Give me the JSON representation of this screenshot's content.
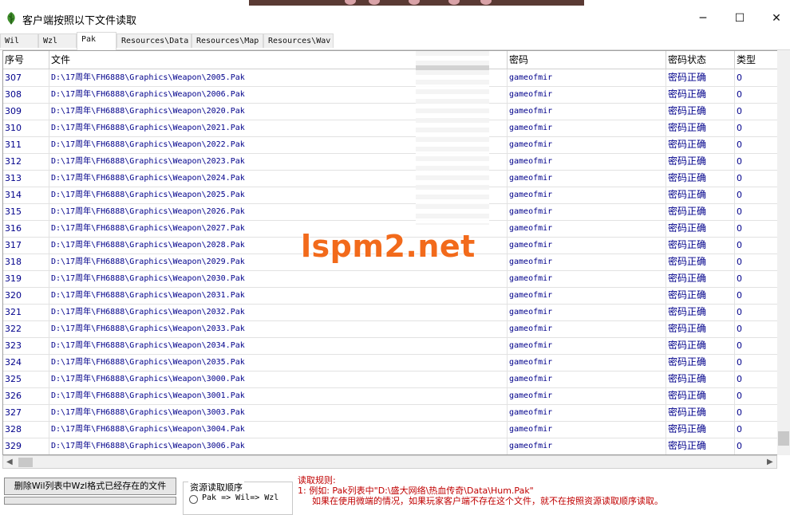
{
  "window": {
    "title": "客户端按照以下文件读取",
    "minimize": "─",
    "maximize": "☐",
    "close": "✕"
  },
  "tabs": [
    "Wil",
    "Wzl",
    "Pak",
    "Resources\\Data",
    "Resources\\Map",
    "Resources\\Wav"
  ],
  "active_tab": "Pak",
  "columns": [
    "序号",
    "文件",
    "密码",
    "密码状态",
    "类型"
  ],
  "rows": [
    [
      "307",
      "D:\\17周年\\FH6888\\Graphics\\Weapon\\2005.Pak",
      "gameofmir",
      "密码正确",
      "0"
    ],
    [
      "308",
      "D:\\17周年\\FH6888\\Graphics\\Weapon\\2006.Pak",
      "gameofmir",
      "密码正确",
      "0"
    ],
    [
      "309",
      "D:\\17周年\\FH6888\\Graphics\\Weapon\\2020.Pak",
      "gameofmir",
      "密码正确",
      "0"
    ],
    [
      "310",
      "D:\\17周年\\FH6888\\Graphics\\Weapon\\2021.Pak",
      "gameofmir",
      "密码正确",
      "0"
    ],
    [
      "311",
      "D:\\17周年\\FH6888\\Graphics\\Weapon\\2022.Pak",
      "gameofmir",
      "密码正确",
      "0"
    ],
    [
      "312",
      "D:\\17周年\\FH6888\\Graphics\\Weapon\\2023.Pak",
      "gameofmir",
      "密码正确",
      "0"
    ],
    [
      "313",
      "D:\\17周年\\FH6888\\Graphics\\Weapon\\2024.Pak",
      "gameofmir",
      "密码正确",
      "0"
    ],
    [
      "314",
      "D:\\17周年\\FH6888\\Graphics\\Weapon\\2025.Pak",
      "gameofmir",
      "密码正确",
      "0"
    ],
    [
      "315",
      "D:\\17周年\\FH6888\\Graphics\\Weapon\\2026.Pak",
      "gameofmir",
      "密码正确",
      "0"
    ],
    [
      "316",
      "D:\\17周年\\FH6888\\Graphics\\Weapon\\2027.Pak",
      "gameofmir",
      "密码正确",
      "0"
    ],
    [
      "317",
      "D:\\17周年\\FH6888\\Graphics\\Weapon\\2028.Pak",
      "gameofmir",
      "密码正确",
      "0"
    ],
    [
      "318",
      "D:\\17周年\\FH6888\\Graphics\\Weapon\\2029.Pak",
      "gameofmir",
      "密码正确",
      "0"
    ],
    [
      "319",
      "D:\\17周年\\FH6888\\Graphics\\Weapon\\2030.Pak",
      "gameofmir",
      "密码正确",
      "0"
    ],
    [
      "320",
      "D:\\17周年\\FH6888\\Graphics\\Weapon\\2031.Pak",
      "gameofmir",
      "密码正确",
      "0"
    ],
    [
      "321",
      "D:\\17周年\\FH6888\\Graphics\\Weapon\\2032.Pak",
      "gameofmir",
      "密码正确",
      "0"
    ],
    [
      "322",
      "D:\\17周年\\FH6888\\Graphics\\Weapon\\2033.Pak",
      "gameofmir",
      "密码正确",
      "0"
    ],
    [
      "323",
      "D:\\17周年\\FH6888\\Graphics\\Weapon\\2034.Pak",
      "gameofmir",
      "密码正确",
      "0"
    ],
    [
      "324",
      "D:\\17周年\\FH6888\\Graphics\\Weapon\\2035.Pak",
      "gameofmir",
      "密码正确",
      "0"
    ],
    [
      "325",
      "D:\\17周年\\FH6888\\Graphics\\Weapon\\3000.Pak",
      "gameofmir",
      "密码正确",
      "0"
    ],
    [
      "326",
      "D:\\17周年\\FH6888\\Graphics\\Weapon\\3001.Pak",
      "gameofmir",
      "密码正确",
      "0"
    ],
    [
      "327",
      "D:\\17周年\\FH6888\\Graphics\\Weapon\\3003.Pak",
      "gameofmir",
      "密码正确",
      "0"
    ],
    [
      "328",
      "D:\\17周年\\FH6888\\Graphics\\Weapon\\3004.Pak",
      "gameofmir",
      "密码正确",
      "0"
    ],
    [
      "329",
      "D:\\17周年\\FH6888\\Graphics\\Weapon\\3006.Pak",
      "gameofmir",
      "密码正确",
      "0"
    ]
  ],
  "watermark": "lspm2.net",
  "bottom": {
    "delete_button": "删除Wil列表中Wzl格式已经存在的文件",
    "group_title": "资源读取顺序",
    "radio_label": "Pak => Wil=> Wzl",
    "rules_title": "读取规则:",
    "rule_1": "1: 例如: Pak列表中\"D:\\盛大网络\\热血传奇\\Data\\Hum.Pak\"",
    "rule_2": "如果在使用微端的情况，如果玩家客户端不存在这个文件，就不在按照资源读取顺序读取。"
  },
  "icons": {
    "app": "green-leaf-app-icon",
    "scroll_left": "◀",
    "scroll_right": "▶",
    "scroll_up": "▲",
    "scroll_down": "▼"
  },
  "colors": {
    "cell_text": "#00008b",
    "watermark": "#f26a1b",
    "rules_text": "#c00000"
  }
}
